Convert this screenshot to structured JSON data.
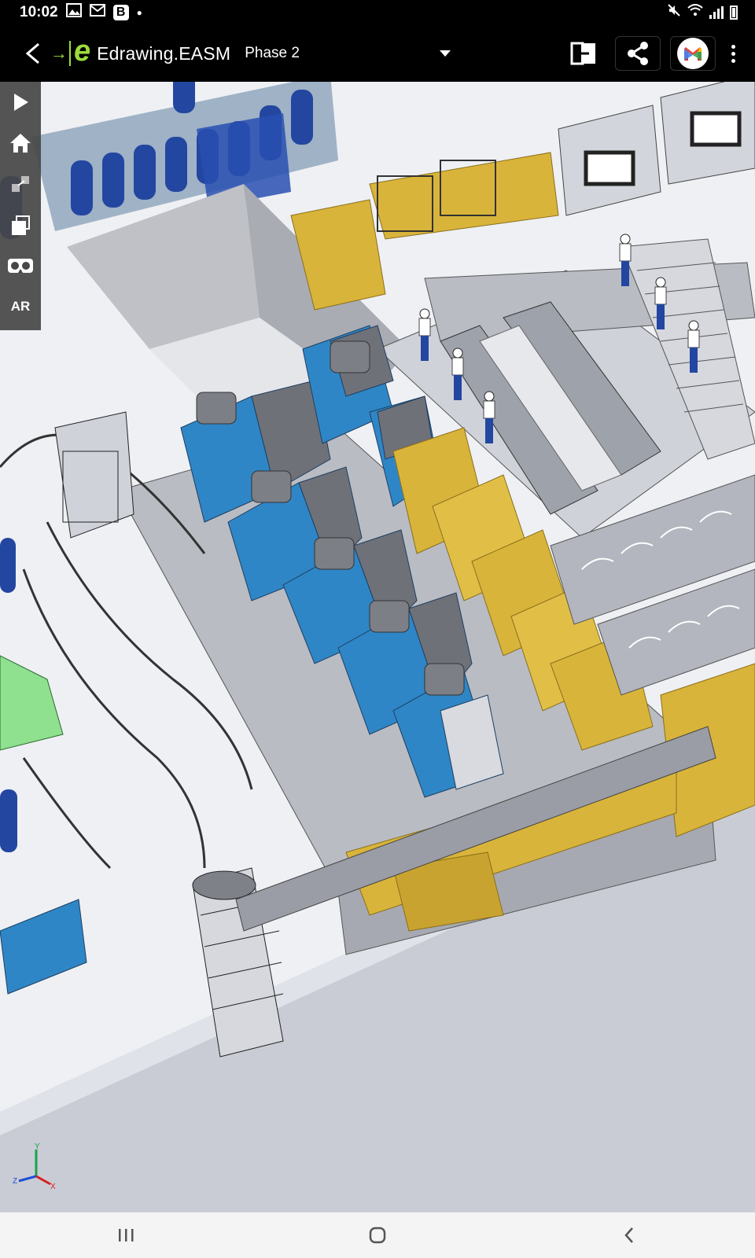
{
  "status": {
    "time": "10:02",
    "notification_icons": [
      "gallery-icon",
      "gmail-icon",
      "b-app-icon",
      "dot-icon"
    ],
    "b_badge": "B",
    "right_icons": [
      "mute-icon",
      "wifi-icon",
      "signal-icon",
      "battery-icon"
    ]
  },
  "appbar": {
    "title": "Edrawing.EASM",
    "configuration": "Phase 2",
    "actions": [
      "exit-fullscreen-icon",
      "share-icon",
      "gmail-icon",
      "more-icon"
    ]
  },
  "toolbar": {
    "items": [
      "play-icon",
      "home-icon",
      "explode-icon",
      "configurations-icon",
      "vr-headset-icon"
    ],
    "ar_label": "AR"
  },
  "triad": {
    "y": "Y",
    "z": "Z",
    "x": "X"
  },
  "colors": {
    "machine_blue": "#2f86c6",
    "machine_gold": "#d9b43a",
    "platform_gray": "#b9bcc3",
    "floor": "#e8eaef",
    "green_part": "#8fe08f"
  },
  "navbar": {
    "items": [
      "recents-icon",
      "home-nav-icon",
      "back-nav-icon"
    ]
  }
}
